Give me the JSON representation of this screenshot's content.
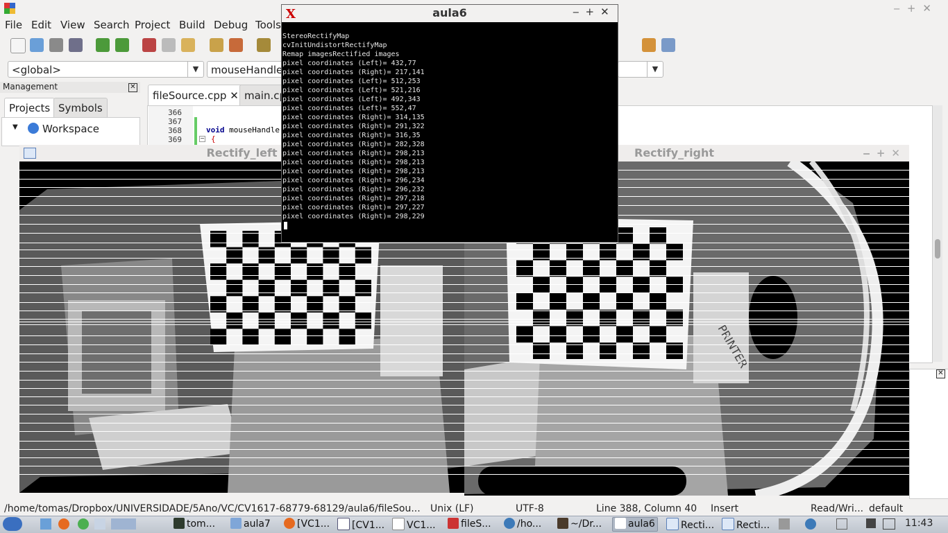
{
  "ide": {
    "menu": [
      "File",
      "Edit",
      "View",
      "Search",
      "Project",
      "Build",
      "Debug",
      "Tools"
    ],
    "scope_combo": "<global>",
    "function_combo": "mouseHandler",
    "management_title": "Management",
    "side_tabs": [
      "Projects",
      "Symbols"
    ],
    "workspace_label": "Workspace",
    "file_tabs": [
      "fileSource.cpp",
      "main.cpp"
    ],
    "line_numbers": [
      "366",
      "367",
      "368",
      "369"
    ],
    "code_keyword": "void",
    "code_line": " mouseHandle",
    "code_brace": "{",
    "status": {
      "path": "/home/tomas/Dropbox/UNIVERSIDADE/5Ano/VC/CV1617-68779-68129/aula6/fileSou...",
      "eol": "Unix (LF)",
      "encoding": "UTF-8",
      "position": "Line 388, Column 40",
      "mode": "Insert",
      "access": "Read/Wri...",
      "lang": "default"
    }
  },
  "terminal": {
    "title": "aula6",
    "lines": [
      "StereoRectifyMap",
      "cvInitUndistortRectifyMap",
      "Remap imagesRectified images",
      "pixel coordinates (Left)= 432,77",
      "pixel coordinates (Right)= 217,141",
      "pixel coordinates (Left)= 512,253",
      "pixel coordinates (Left)= 521,216",
      "pixel coordinates (Left)= 492,343",
      "pixel coordinates (Left)= 552,47",
      "pixel coordinates (Right)= 314,135",
      "pixel coordinates (Right)= 291,322",
      "pixel coordinates (Right)= 316,35",
      "pixel coordinates (Right)= 282,328",
      "pixel coordinates (Right)= 298,213",
      "pixel coordinates (Right)= 298,213",
      "pixel coordinates (Right)= 298,213",
      "pixel coordinates (Right)= 296,234",
      "pixel coordinates (Right)= 296,232",
      "pixel coordinates (Right)= 297,218",
      "pixel coordinates (Right)= 297,227",
      "pixel coordinates (Right)= 298,229"
    ]
  },
  "windows": {
    "left_title": "Rectify_left",
    "right_title": "Rectify_right",
    "sign_text": "PRINTER"
  },
  "taskbar": {
    "items": [
      "tom...",
      "aula7",
      "[VC1...",
      "[CV1...",
      "VC1...",
      "fileS...",
      "/ho...",
      "~/Dr...",
      "aula6",
      "Recti...",
      "Recti..."
    ],
    "clock": "11:43"
  },
  "colors": {
    "terminal_bg": "#000000",
    "image_bg": "#000000",
    "accent_blue": "#3b7bd8"
  }
}
